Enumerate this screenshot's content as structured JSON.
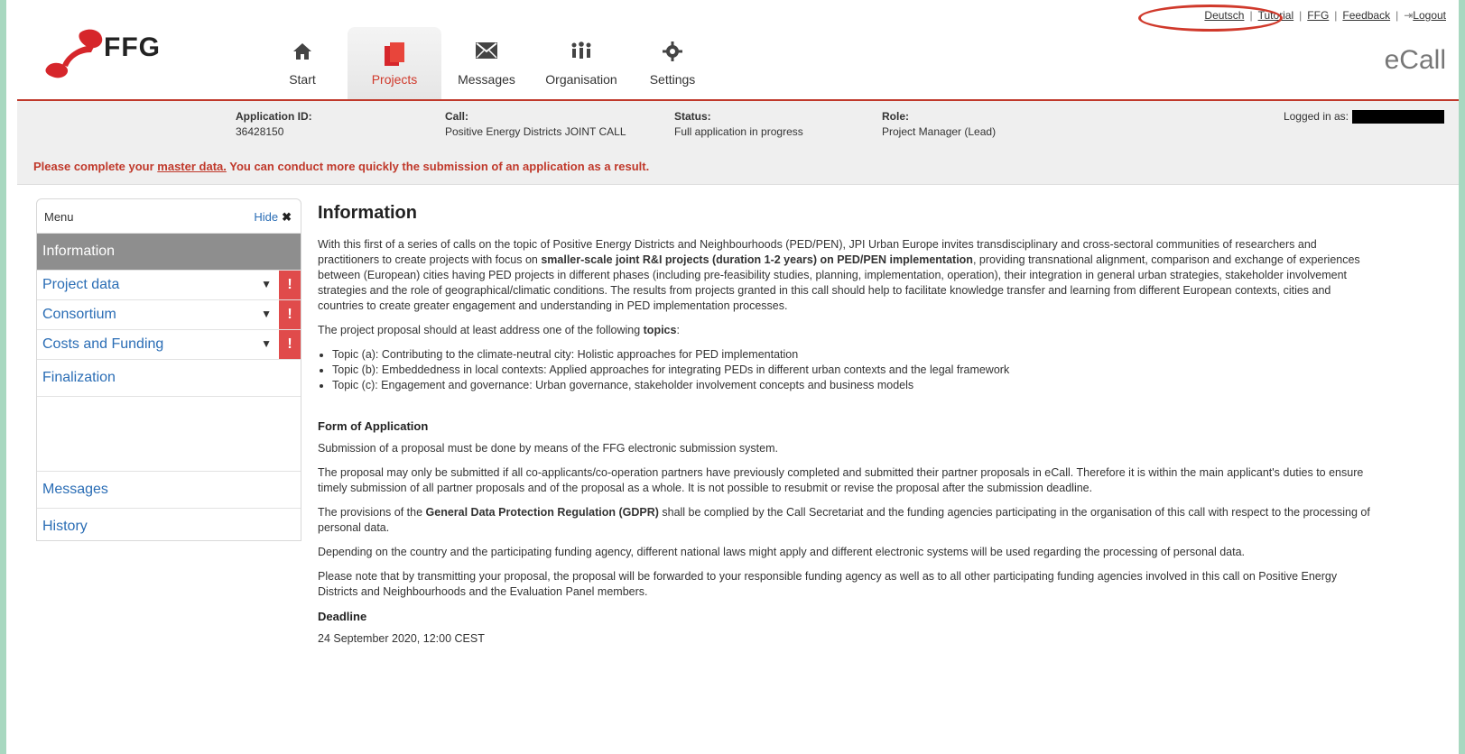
{
  "top_links": {
    "deutsch": "Deutsch",
    "tutorial": "Tutorial",
    "ffg": "FFG",
    "feedback": "Feedback",
    "logout": "Logout"
  },
  "logo": {
    "text": "FFG"
  },
  "brand_right": "eCall",
  "nav": [
    {
      "label": "Start",
      "icon": "home-icon"
    },
    {
      "label": "Projects",
      "icon": "projects-icon"
    },
    {
      "label": "Messages",
      "icon": "envelope-icon"
    },
    {
      "label": "Organisation",
      "icon": "organisation-icon"
    },
    {
      "label": "Settings",
      "icon": "gear-icon"
    }
  ],
  "info": {
    "application_id_label": "Application ID:",
    "application_id_value": "36428150",
    "call_label": "Call:",
    "call_value": "Positive Energy Districts JOINT CALL",
    "status_label": "Status:",
    "status_value": "Full application in progress",
    "role_label": "Role:",
    "role_value": "Project Manager (Lead)",
    "logged_in_label": "Logged in as:"
  },
  "warning": {
    "prefix": "Please complete your ",
    "link": "master data.",
    "suffix": " You can conduct more quickly the submission of an application as a result."
  },
  "sidebar": {
    "title": "Menu",
    "hide_label": "Hide",
    "items": [
      {
        "label": "Information"
      },
      {
        "label": "Project data"
      },
      {
        "label": "Consortium"
      },
      {
        "label": "Costs and Funding"
      },
      {
        "label": "Finalization"
      },
      {
        "label": "Messages"
      },
      {
        "label": "History"
      }
    ],
    "alert_symbol": "!"
  },
  "content": {
    "title": "Information",
    "p1_a": "With this first of a series of calls on the topic of Positive Energy Districts and Neighbourhoods (PED/PEN), JPI Urban Europe invites transdisciplinary and cross-sectoral communities of researchers and practitioners to create projects with focus on ",
    "p1_bold": "smaller-scale joint R&I projects (duration 1-2 years) on PED/PEN implementation",
    "p1_b": ", providing transnational alignment, comparison and exchange of experiences between (European) cities having PED projects in different phases (including pre-feasibility studies, planning, implementation, operation), their integration in general urban strategies, stakeholder involvement strategies and the role of geographical/climatic conditions. The results from projects granted in this call should help to facilitate knowledge transfer and learning from different European contexts, cities and countries to create greater engagement and understanding in PED implementation processes.",
    "p2_a": "The project proposal should at least address one of the following ",
    "p2_bold": "topics",
    "p2_b": ":",
    "topics": [
      "Topic (a): Contributing to the climate-neutral city: Holistic approaches for PED implementation",
      "Topic (b): Embeddedness in local contexts: Applied approaches for integrating PEDs in different urban contexts and the legal framework",
      "Topic (c): Engagement and governance: Urban governance, stakeholder involvement concepts and business models"
    ],
    "form_heading": "Form of Application",
    "p3": "Submission of a proposal must be done by means of the FFG electronic submission system.",
    "p4": "The proposal may only be submitted if all co-applicants/co-operation partners have previously completed and submitted their partner proposals in eCall. Therefore it is within the main applicant's duties to ensure timely submission of all partner proposals and of the proposal as a whole. It is not possible to resubmit or revise the proposal after the submission deadline.",
    "p5_a": "The provisions of the ",
    "p5_bold": "General Data Protection Regulation (GDPR)",
    "p5_b": " shall be complied by the Call Secretariat and the funding agencies participating in the organisation of this call with respect to the processing of personal data.",
    "p6": "Depending on the country and the participating funding agency, different national laws might apply and different electronic systems will be used regarding the processing of personal data.",
    "p7": "Please note that by transmitting your proposal, the proposal will be forwarded to your responsible funding agency as well as to all other participating funding agencies involved in this call on Positive Energy Districts and Neighbourhoods and the Evaluation Panel members.",
    "deadline_heading": "Deadline",
    "deadline_value": "24 September 2020, 12:00 CEST"
  },
  "colors": {
    "accent_red": "#c0392b",
    "link_blue": "#2a6db5",
    "background_green": "#a8d8c0"
  }
}
